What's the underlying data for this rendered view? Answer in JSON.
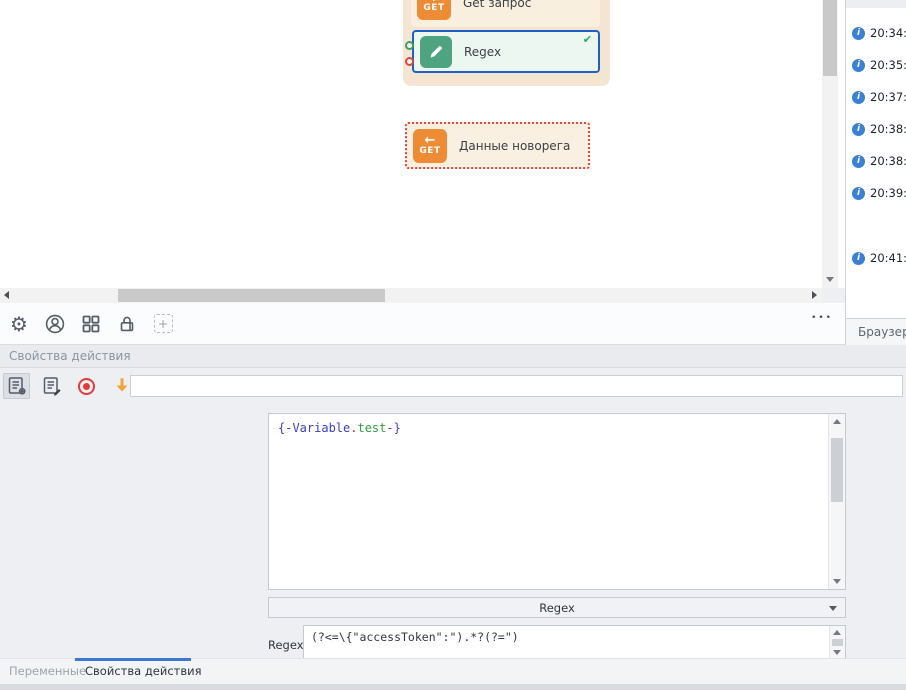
{
  "colors": {
    "accent_blue": "#2160c4",
    "tab_accent_blue": "#3a78d2",
    "success_green": "#27a85f",
    "action_green": "#4ea381",
    "action_orange": "#ee8c36",
    "error_red": "#e04a3a",
    "record_red": "#e23b3b",
    "info_blue": "#3b7fd6",
    "arrow_orange": "#f2a33c"
  },
  "canvas": {
    "get_node": {
      "badge": "GET",
      "badge_arrow": "↑",
      "label": "Get запрос"
    },
    "regex_node": {
      "label": "Regex",
      "check": "✔"
    },
    "novoreg_node": {
      "badge": "GET",
      "badge_arrow": "←",
      "label": "Данные новорега"
    }
  },
  "canvas_toolbar": {
    "more": "•••"
  },
  "log": {
    "tab_label": "Браузер",
    "items": [
      {
        "time": "20:34:"
      },
      {
        "time": "20:35:"
      },
      {
        "time": "20:37:"
      },
      {
        "time": "20:38:"
      },
      {
        "time": "20:38:"
      },
      {
        "time": "20:39:"
      },
      {
        "time": "20:41:"
      }
    ]
  },
  "properties": {
    "title": "Свойства действия",
    "filter_value": "",
    "macro": {
      "open": "{-Variable",
      "dot": ".",
      "name": "test",
      "close": "-}"
    },
    "type_dropdown": "Regex",
    "regex_label": "Regex",
    "regex_pattern": "(?<=\\{\"accessToken\":\").*?(?=\")"
  },
  "bottom_tabs": {
    "variables": "Переменные",
    "action_properties": "Свойства действия"
  }
}
